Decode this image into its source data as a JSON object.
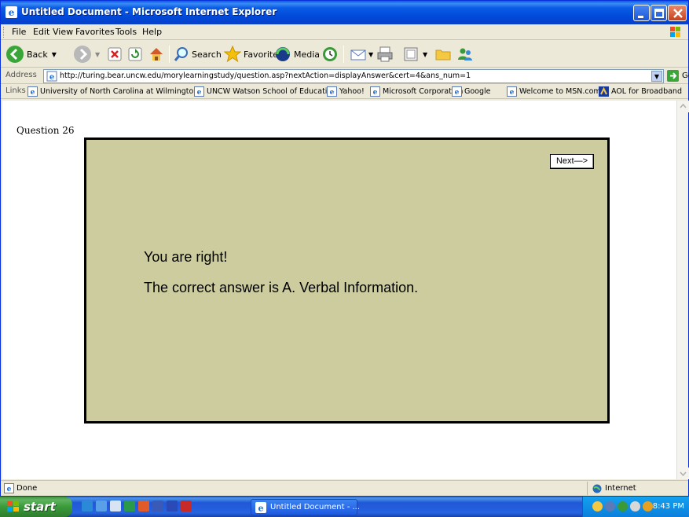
{
  "window": {
    "title": "Untitled Document - Microsoft Internet Explorer"
  },
  "menu": [
    "File",
    "Edit",
    "View",
    "Favorites",
    "Tools",
    "Help"
  ],
  "toolbar": {
    "back_label": "Back",
    "search_label": "Search",
    "favorites_label": "Favorites",
    "media_label": "Media"
  },
  "address": {
    "label": "Address",
    "url": "http://turing.bear.uncw.edu/morylearningstudy/question.asp?nextAction=displayAnswer&cert=4&ans_num=1",
    "go_label": "Go"
  },
  "links": {
    "label": "Links",
    "items": [
      "University of North Carolina at Wilmington",
      "UNCW Watson School of Education",
      "Yahoo!",
      "Microsoft Corporation",
      "Google",
      "Welcome to MSN.com",
      "AOL for Broadband"
    ]
  },
  "page": {
    "question_label": "Question 26",
    "next_button": "Next—>",
    "feedback": "You are right!",
    "answer": "The correct answer is A. Verbal Information.",
    "panel_color": "#cccc9e"
  },
  "status": {
    "text": "Done",
    "zone": "Internet"
  },
  "taskbar": {
    "start_label": "start",
    "task_label": "Untitled Document - ...",
    "clock": "8:43 PM"
  }
}
